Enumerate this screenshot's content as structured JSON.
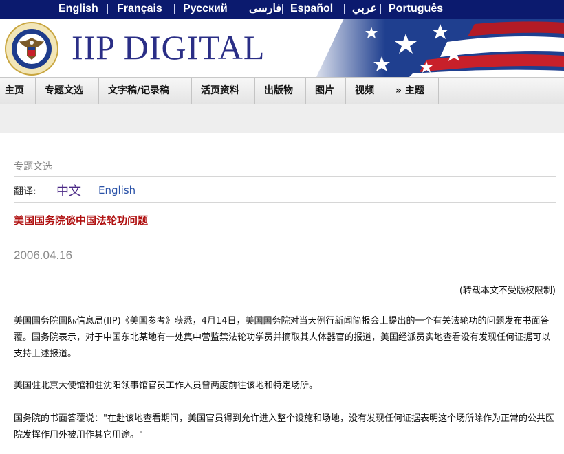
{
  "language_bar": {
    "languages": [
      "English",
      "Français",
      "Русский",
      "فارسی",
      "Español",
      "عربي",
      "Português"
    ]
  },
  "header": {
    "brand": "IIP DIGITAL",
    "seal_text": "UNITED STATES OF AMERICA · EMBASSY"
  },
  "nav": {
    "items": [
      "主页",
      "专题文选",
      "文字稿/记录稿",
      "活页资料",
      "出版物",
      "图片",
      "视频",
      "» 主题"
    ]
  },
  "breadcrumb": "专题文选",
  "translation": {
    "label": "翻译:",
    "chinese": "中文",
    "english": "English"
  },
  "article": {
    "title": "美国国务院谈中国法轮功问题",
    "date": "2006.04.16",
    "notice": "(转载本文不受版权限制)",
    "paragraphs": [
      "美国国务院国际信息局(IIP)《美国参考》获悉，4月14日，美国国务院对当天例行新闻简报会上提出的一个有关法轮功的问题发布书面答覆。国务院表示，对于中国东北某地有一处集中营监禁法轮功学员并摘取其人体器官的报道，美国经派员实地查看没有发现任何证据可以支持上述报道。",
      "美国驻北京大使馆和驻沈阳领事馆官员工作人员曾两度前往该地和特定场所。",
      "国务院的书面答覆说：\"在赴该地查看期间，美国官员得到允许进入整个设施和场地，没有发现任何证据表明这个场所除作为正常的公共医院发挥作用外被用作其它用途。\""
    ]
  },
  "colors": {
    "lang_bar": "#0b1a6e",
    "brand": "#2a2e86",
    "title": "#b01212",
    "link": "#2b53a8",
    "chinese_link": "#4b2a86"
  }
}
